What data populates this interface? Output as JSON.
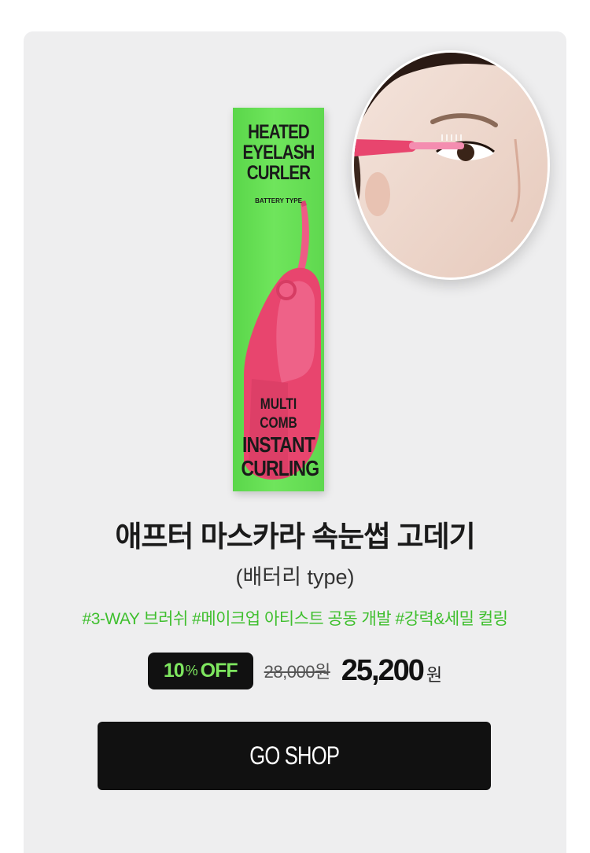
{
  "product_box": {
    "top_lines": [
      "HEATED",
      "EYELASH",
      "CURLER"
    ],
    "subtype": "BATTERY TYPE",
    "bottom_small": "MULTI COMB",
    "bottom_lines": [
      "INSTANT",
      "CURLING"
    ]
  },
  "product": {
    "title": "애프터 마스카라 속눈썹 고데기",
    "subtitle": "(배터리 type)",
    "hashtags": "#3-WAY 브러쉬 #메이크업 아티스트 공동 개발 #강력&세밀 컬링"
  },
  "price": {
    "discount_number": "10",
    "discount_pct": "%",
    "discount_off": "OFF",
    "original": "28,000원",
    "sale": "25,200",
    "sale_unit": "원"
  },
  "cta": {
    "label": "GO SHOP"
  },
  "colors": {
    "accent_green": "#3fbf2e",
    "badge_text": "#7ee65f",
    "box_green": "#5fd84f",
    "curler_pink": "#e8456e"
  }
}
